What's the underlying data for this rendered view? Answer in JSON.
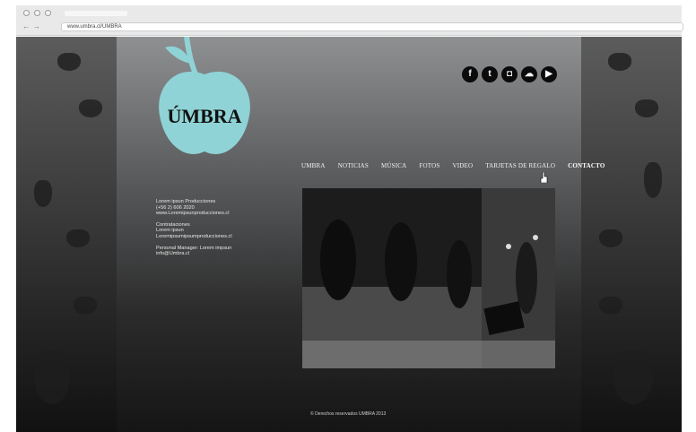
{
  "browser": {
    "url": "www.umbra.cl/UMBRA"
  },
  "logo": {
    "text": "ÚMBRA"
  },
  "social": [
    {
      "icon": "facebook-icon",
      "glyph": "f"
    },
    {
      "icon": "twitter-icon",
      "glyph": "t"
    },
    {
      "icon": "instagram-icon",
      "glyph": "◘"
    },
    {
      "icon": "soundcloud-icon",
      "glyph": "☁"
    },
    {
      "icon": "youtube-icon",
      "glyph": "▶"
    }
  ],
  "nav": [
    {
      "label": "UMBRA"
    },
    {
      "label": "NOTICIAS"
    },
    {
      "label": "MÚSICA"
    },
    {
      "label": "FOTOS"
    },
    {
      "label": "VIDEO"
    },
    {
      "label": "TARJETAS DE REGALO"
    },
    {
      "label": "CONTACTO",
      "active": true
    }
  ],
  "contact": {
    "producciones": {
      "name": "Lorem ipsun Producciones",
      "phone": "(+56 2) 606 2020",
      "web": "www.Loremipsunproducciones.cl"
    },
    "contrataciones": {
      "title": "Contrataciones",
      "name": "Lorem ipsun",
      "email": "Loremipsumipsumproducciones.cl"
    },
    "manager": {
      "title": "Personal Manager: Lorem impsun",
      "email": "info@Umbra.cl"
    }
  },
  "footer": {
    "text": "© Derechos reservados UMBRA 2013"
  },
  "colors": {
    "apple": "#8fd3d6",
    "page_bg": "#121212",
    "nav_text": "#f2f2f2"
  }
}
